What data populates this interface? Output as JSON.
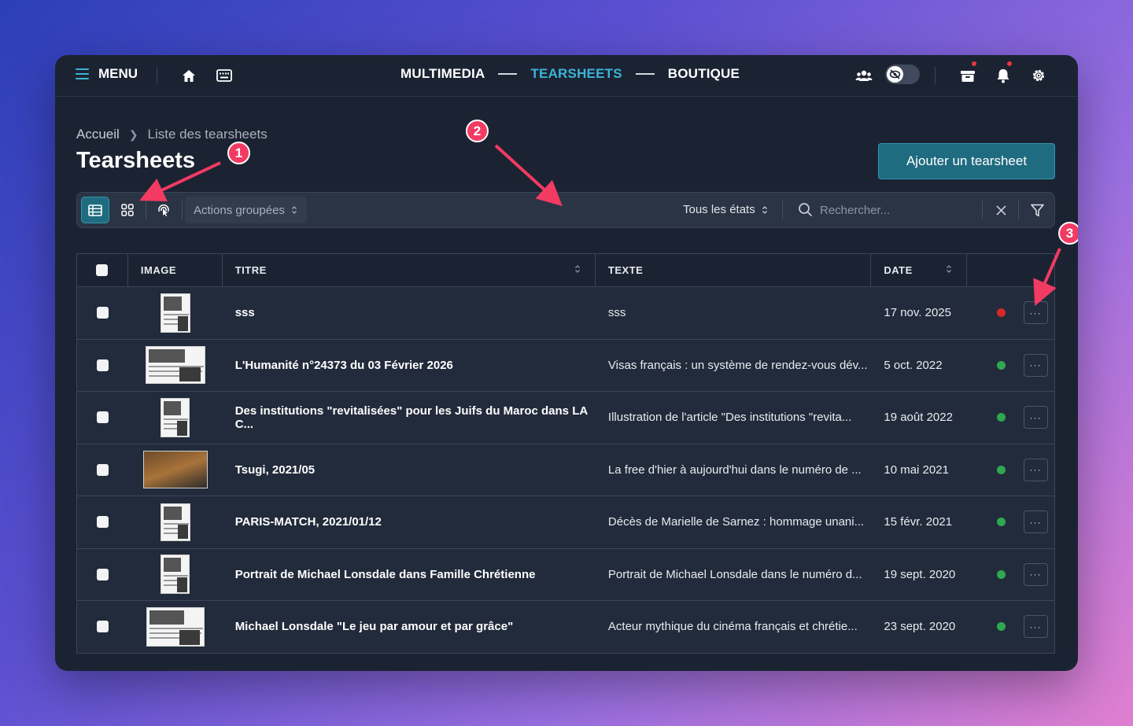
{
  "nav": {
    "menu_label": "MENU",
    "center": [
      "MULTIMEDIA",
      "TEARSHEETS",
      "BOUTIQUE"
    ],
    "active": "TEARSHEETS"
  },
  "breadcrumb": [
    "Accueil",
    "Liste des tearsheets"
  ],
  "page_title": "Tearsheets",
  "add_button": "Ajouter un tearsheet",
  "toolbar": {
    "actions_label": "Actions groupées",
    "states_label": "Tous les états",
    "search_placeholder": "Rechercher..."
  },
  "table": {
    "headers": {
      "image": "IMAGE",
      "title": "TITRE",
      "text": "TEXTE",
      "date": "DATE"
    },
    "rows": [
      {
        "title": "sss",
        "text": "sss",
        "date": "17 nov. 2025",
        "status": "red"
      },
      {
        "title": "L'Humanité n°24373 du 03 Février 2026",
        "text": "Visas français : un système de rendez-vous dév...",
        "date": "5 oct. 2022",
        "status": "green"
      },
      {
        "title": "Des institutions \"revitalisées\" pour les Juifs du Maroc dans LA C...",
        "text": "Illustration de l'article \"Des institutions \"revita...",
        "date": "19 août 2022",
        "status": "green"
      },
      {
        "title": "Tsugi, 2021/05",
        "text": "La free d'hier à aujourd'hui dans le numéro de ...",
        "date": "10 mai 2021",
        "status": "green"
      },
      {
        "title": "PARIS-MATCH, 2021/01/12",
        "text": "Décès de Marielle de Sarnez : hommage unani...",
        "date": "15 févr. 2021",
        "status": "green"
      },
      {
        "title": "Portrait de Michael Lonsdale dans Famille Chrétienne",
        "text": "Portrait de Michael Lonsdale dans le numéro d...",
        "date": "19 sept. 2020",
        "status": "green"
      },
      {
        "title": "Michael Lonsdale \"Le jeu par amour et par grâce\"",
        "text": "Acteur mythique du cinéma français et chrétie...",
        "date": "23 sept. 2020",
        "status": "green"
      }
    ],
    "more_button": "···"
  },
  "annotations": [
    "1",
    "2",
    "3"
  ],
  "colors": {
    "accent": "#3bb4d6",
    "status_red": "#d62828",
    "status_green": "#2fa84f",
    "marker": "#f23a62"
  }
}
